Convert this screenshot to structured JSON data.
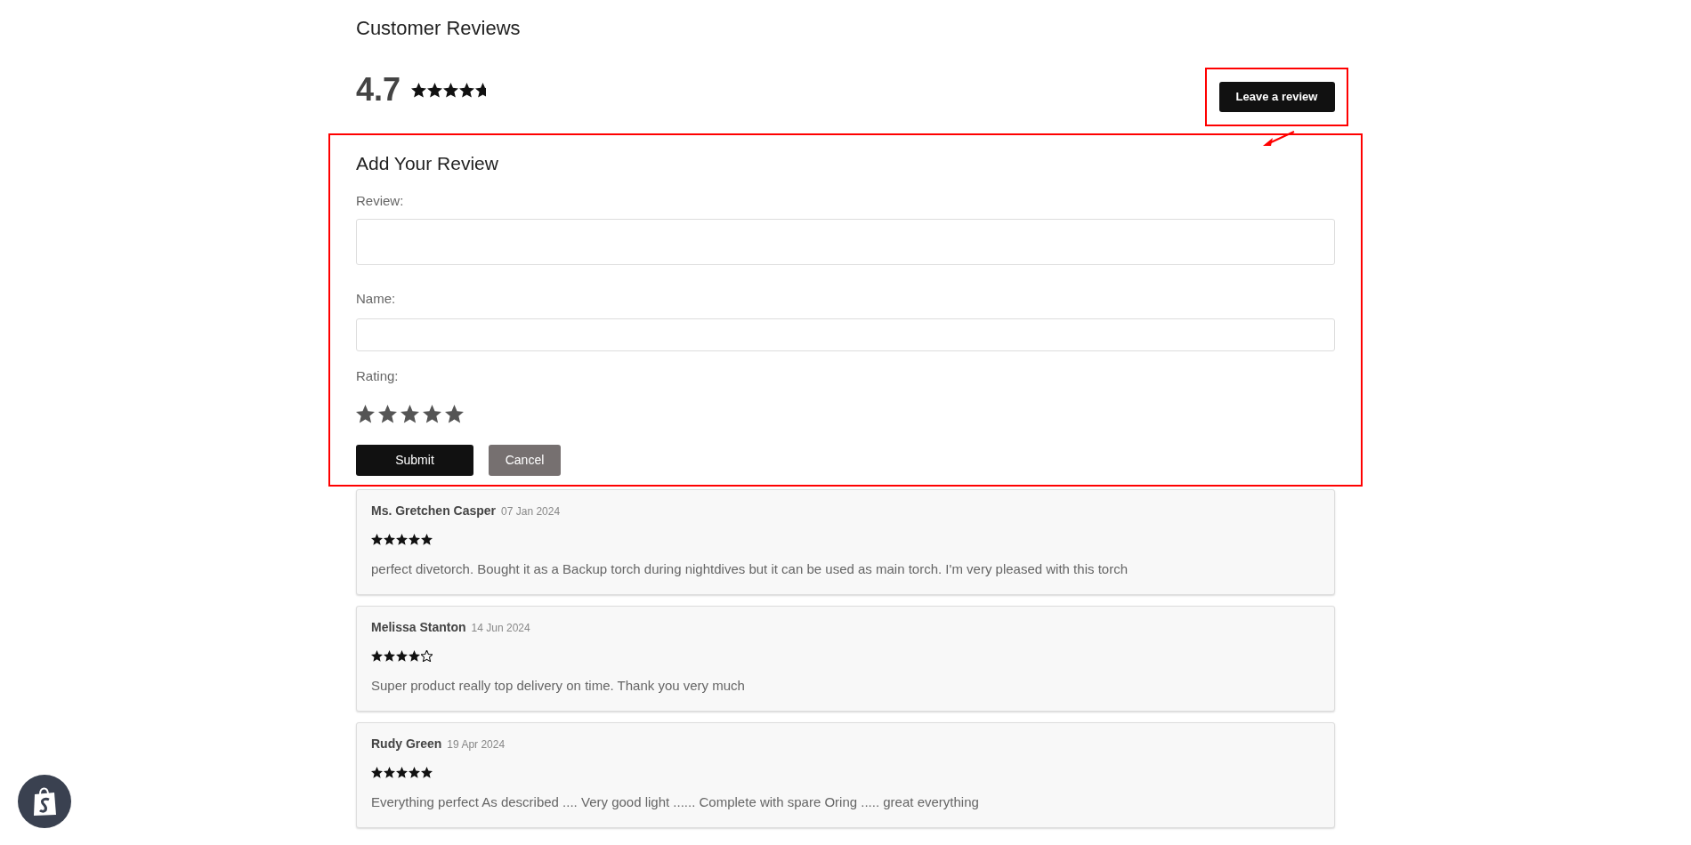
{
  "heading": "Customer Reviews",
  "summary": {
    "score": "4.7",
    "stars": 4.7
  },
  "leave_review_button": "Leave a review",
  "form": {
    "title": "Add Your Review",
    "fields": [
      {
        "label": "Review:",
        "kind": "textarea"
      },
      {
        "label": "Name:",
        "kind": "text"
      }
    ],
    "rating": {
      "label": "Rating:"
    },
    "buttons": [
      {
        "label": "Submit",
        "kind": "primary"
      },
      {
        "label": "Cancel",
        "kind": "secondary"
      }
    ]
  },
  "reviews": [
    {
      "name": "Ms. Gretchen Casper",
      "date": "07 Jan 2024",
      "stars": 5,
      "text": "perfect divetorch. Bought it as a Backup torch during nightdives but it can be used as main torch. I'm very pleased with this torch"
    },
    {
      "name": "Melissa Stanton",
      "date": "14 Jun 2024",
      "stars": 4,
      "text": "Super product really top delivery on time. Thank you very much"
    },
    {
      "name": "Rudy Green",
      "date": "19 Apr 2024",
      "stars": 5,
      "text": "Everything perfect As described .... Very good light ...... Complete with spare Oring ..... great everything"
    }
  ]
}
